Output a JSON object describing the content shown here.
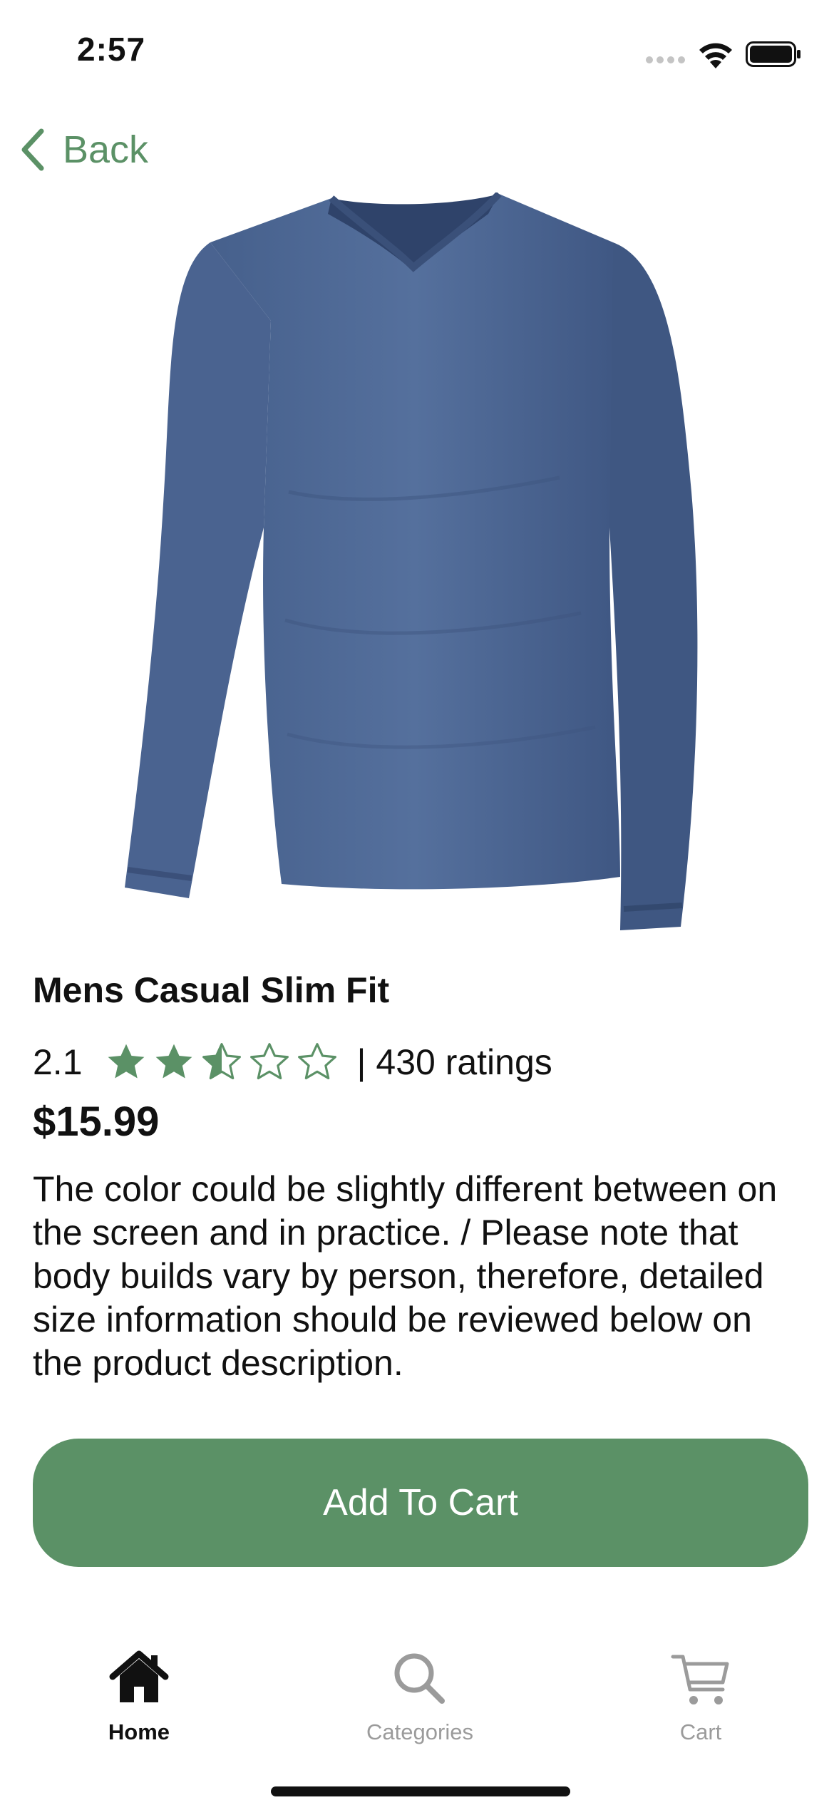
{
  "status_bar": {
    "time": "2:57",
    "icons": [
      "signal-icon",
      "wifi-icon",
      "battery-icon"
    ]
  },
  "nav": {
    "back_label": "Back",
    "back_icon": "chevron-left-icon"
  },
  "product": {
    "image_icon": "long-sleeve-shirt-image",
    "title": "Mens Casual Slim Fit",
    "rating": "2.1",
    "stars": {
      "filled": 2,
      "half": 1,
      "empty": 2
    },
    "ratings_count": "| 430 ratings",
    "price": "$15.99",
    "description": "The color could be slightly different between on the screen and in practice. / Please note that body builds vary by person, therefore, detailed size information should be reviewed below on the product description."
  },
  "actions": {
    "add_to_cart": "Add To Cart"
  },
  "tab_bar": {
    "tabs": [
      {
        "label": "Home",
        "icon": "home-icon",
        "active": true
      },
      {
        "label": "Categories",
        "icon": "search-icon",
        "active": false
      },
      {
        "label": "Cart",
        "icon": "cart-icon",
        "active": false
      }
    ]
  },
  "colors": {
    "accent": "#5b9166",
    "text": "#111111",
    "inactive": "#9b9b9b",
    "shirt": "#4f6693"
  }
}
